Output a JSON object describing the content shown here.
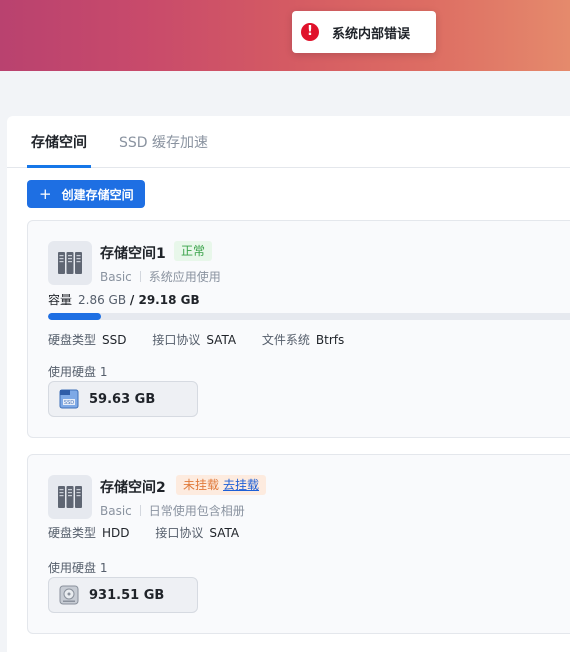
{
  "toast": {
    "message": "系统内部错误",
    "icon": "error-icon"
  },
  "tabs": [
    {
      "label": "存储空间",
      "active": true
    },
    {
      "label": "SSD 缓存加速",
      "active": false
    }
  ],
  "create_button": {
    "label": "创建存储空间",
    "icon": "plus-icon"
  },
  "pools": [
    {
      "name": "存储空间1",
      "status": "正常",
      "type": "Basic",
      "purpose": "系统应用使用",
      "capacity_label": "容量",
      "used": "2.86 GB",
      "total": "/ 29.18 GB",
      "usage_fraction": 0.098,
      "props": [
        {
          "label": "硬盘类型",
          "value": "SSD"
        },
        {
          "label": "接口协议",
          "value": "SATA"
        },
        {
          "label": "文件系统",
          "value": "Btrfs"
        }
      ],
      "disks_label": "使用硬盘 1",
      "disk_size": "59.63 GB",
      "disk_icon": "ssd-icon"
    },
    {
      "name": "存储空间2",
      "status": "未挂载",
      "action": "去挂载",
      "type": "Basic",
      "purpose": "日常使用包含相册",
      "props": [
        {
          "label": "硬盘类型",
          "value": "HDD"
        },
        {
          "label": "接口协议",
          "value": "SATA"
        }
      ],
      "disks_label": "使用硬盘 1",
      "disk_size": "931.51 GB",
      "disk_icon": "hdd-icon"
    }
  ],
  "colors": {
    "accent": "#1e6fe3",
    "ok": "#3aa34a",
    "warn": "#e07a3a",
    "error": "#e0122b"
  }
}
